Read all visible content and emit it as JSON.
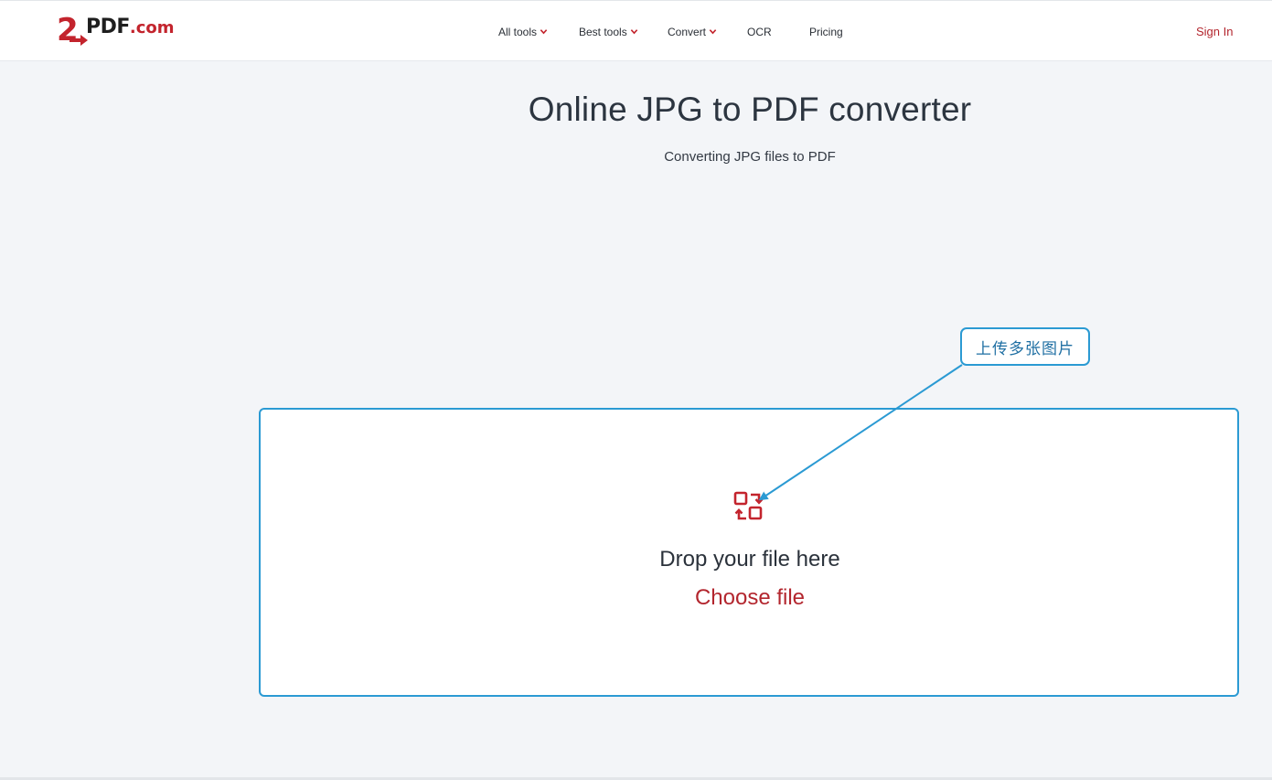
{
  "header": {
    "logo": {
      "mark": "2",
      "text_main": "PDF",
      "text_suffix": ".com"
    },
    "nav": [
      {
        "label": "All tools",
        "has_dropdown": true
      },
      {
        "label": "Best tools",
        "has_dropdown": true
      },
      {
        "label": "Convert",
        "has_dropdown": true
      },
      {
        "label": "OCR",
        "has_dropdown": false
      },
      {
        "label": "Pricing",
        "has_dropdown": false
      }
    ],
    "sign_in": "Sign In"
  },
  "main": {
    "title": "Online JPG to PDF converter",
    "subtitle": "Converting JPG files to PDF",
    "dropzone": {
      "icon": "upload-files-icon",
      "drop_text": "Drop your file here",
      "choose_file": "Choose file"
    }
  },
  "annotation": {
    "callout_text": "上传多张图片"
  },
  "colors": {
    "accent_red": "#b3262e",
    "annotation_blue": "#2b9ad3",
    "background": "#f3f5f8"
  }
}
